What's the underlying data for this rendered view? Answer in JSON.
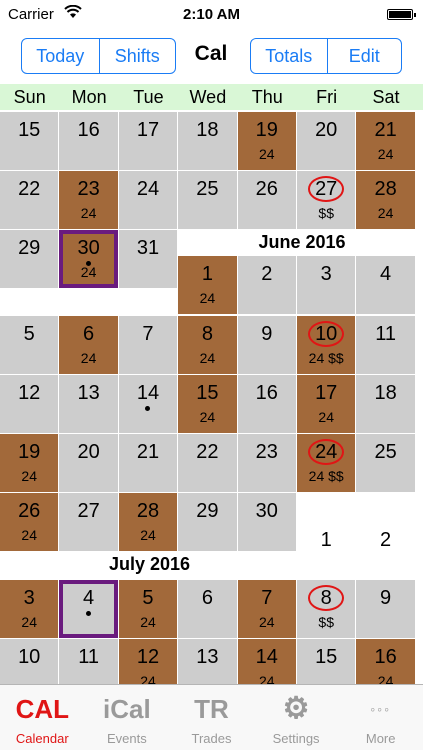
{
  "status": {
    "carrier": "Carrier",
    "time": "2:10 AM"
  },
  "nav": {
    "left_segment": [
      "Today",
      "Shifts"
    ],
    "title": "Cal",
    "right_segment": [
      "Totals",
      "Edit"
    ]
  },
  "weekdays": [
    "Sun",
    "Mon",
    "Tue",
    "Wed",
    "Thu",
    "Fri",
    "Sat"
  ],
  "month_labels": [
    "June 2016",
    "July 2016"
  ],
  "calendar": [
    {
      "d": "15",
      "s": "gray"
    },
    {
      "d": "16",
      "s": "gray"
    },
    {
      "d": "17",
      "s": "gray"
    },
    {
      "d": "18",
      "s": "gray"
    },
    {
      "d": "19",
      "s": "brown",
      "sub": "24"
    },
    {
      "d": "20",
      "s": "gray"
    },
    {
      "d": "21",
      "s": "brown",
      "sub": "24"
    },
    {
      "d": "22",
      "s": "gray"
    },
    {
      "d": "23",
      "s": "brown",
      "sub": "24"
    },
    {
      "d": "24",
      "s": "gray"
    },
    {
      "d": "25",
      "s": "gray"
    },
    {
      "d": "26",
      "s": "gray"
    },
    {
      "d": "27",
      "s": "gray",
      "sub": "$$",
      "circle": true
    },
    {
      "d": "28",
      "s": "brown",
      "sub": "24"
    },
    {
      "d": "29",
      "s": "gray"
    },
    {
      "d": "30",
      "s": "brown",
      "sub": "24",
      "dot": true,
      "today": true
    },
    {
      "d": "31",
      "s": "gray"
    },
    {
      "d": "1",
      "s": "brown",
      "sub": "24"
    },
    {
      "d": "2",
      "s": "gray"
    },
    {
      "d": "3",
      "s": "gray"
    },
    {
      "d": "4",
      "s": "gray"
    },
    {
      "d": "5",
      "s": "gray"
    },
    {
      "d": "6",
      "s": "brown",
      "sub": "24"
    },
    {
      "d": "7",
      "s": "gray"
    },
    {
      "d": "8",
      "s": "brown",
      "sub": "24"
    },
    {
      "d": "9",
      "s": "gray"
    },
    {
      "d": "10",
      "s": "brown",
      "sub": "24 $$",
      "circle": true
    },
    {
      "d": "11",
      "s": "gray"
    },
    {
      "d": "12",
      "s": "gray"
    },
    {
      "d": "13",
      "s": "gray"
    },
    {
      "d": "14",
      "s": "gray",
      "dot": true
    },
    {
      "d": "15",
      "s": "brown",
      "sub": "24"
    },
    {
      "d": "16",
      "s": "gray"
    },
    {
      "d": "17",
      "s": "brown",
      "sub": "24"
    },
    {
      "d": "18",
      "s": "gray"
    },
    {
      "d": "19",
      "s": "brown",
      "sub": "24"
    },
    {
      "d": "20",
      "s": "gray"
    },
    {
      "d": "21",
      "s": "gray"
    },
    {
      "d": "22",
      "s": "gray"
    },
    {
      "d": "23",
      "s": "gray"
    },
    {
      "d": "24",
      "s": "brown",
      "sub": "24 $$",
      "circle": true
    },
    {
      "d": "25",
      "s": "gray"
    },
    {
      "d": "26",
      "s": "brown",
      "sub": "24"
    },
    {
      "d": "27",
      "s": "gray"
    },
    {
      "d": "28",
      "s": "brown",
      "sub": "24"
    },
    {
      "d": "29",
      "s": "gray"
    },
    {
      "d": "30",
      "s": "gray"
    },
    {
      "d": "1",
      "s": "white"
    },
    {
      "d": "2",
      "s": "white"
    },
    {
      "d": "3",
      "s": "brown",
      "sub": "24"
    },
    {
      "d": "4",
      "s": "gray",
      "dot": true,
      "today": true
    },
    {
      "d": "5",
      "s": "brown",
      "sub": "24"
    },
    {
      "d": "6",
      "s": "gray"
    },
    {
      "d": "7",
      "s": "brown",
      "sub": "24"
    },
    {
      "d": "8",
      "s": "gray",
      "sub": "$$",
      "circle": true
    },
    {
      "d": "9",
      "s": "gray"
    },
    {
      "d": "10",
      "s": "gray"
    },
    {
      "d": "11",
      "s": "gray"
    },
    {
      "d": "12",
      "s": "brown",
      "sub": "24"
    },
    {
      "d": "13",
      "s": "gray"
    },
    {
      "d": "14",
      "s": "brown",
      "sub": "24"
    },
    {
      "d": "15",
      "s": "gray"
    },
    {
      "d": "16",
      "s": "brown",
      "sub": "24"
    }
  ],
  "tabs": [
    {
      "icon": "CAL",
      "label": "Calendar",
      "active": true,
      "icon_name": "cal-icon"
    },
    {
      "icon": "iCal",
      "label": "Events",
      "active": false,
      "icon_name": "ical-icon"
    },
    {
      "icon": "TR",
      "label": "Trades",
      "active": false,
      "icon_name": "trades-icon"
    },
    {
      "icon": "⚙",
      "label": "Settings",
      "active": false,
      "icon_name": "gears-icon"
    },
    {
      "icon": "◦◦◦",
      "label": "More",
      "active": false,
      "icon_name": "more-icon"
    }
  ],
  "colors": {
    "accent": "#1a7cf5",
    "shift": "#a2693a",
    "free": "#cdcdcd",
    "today_border": "#6a1b7e",
    "payday_circle": "#e01515",
    "weekday_header": "#d9f7d6"
  }
}
